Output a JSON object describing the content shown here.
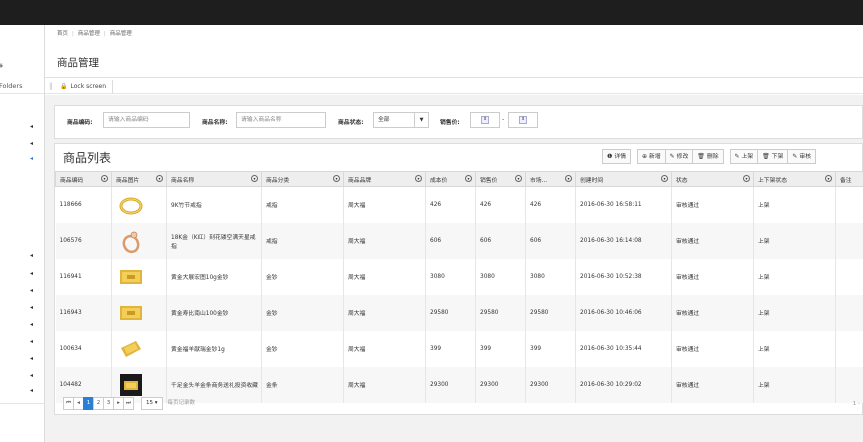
{
  "sidebar": {
    "top_label": "#",
    "folders_label": "Folders"
  },
  "breadcrumb": [
    "首页",
    "商品管理",
    "商品管理"
  ],
  "page_title": "商品管理",
  "tabs": {
    "lock_screen": "Lock screen"
  },
  "search": {
    "code_label": "商品编码:",
    "code_placeholder": "请输入商品编码",
    "name_label": "商品名称:",
    "name_placeholder": "请输入商品名称",
    "status_label": "商品状态:",
    "status_value": "全部",
    "price_label": "销售价:",
    "price_sep": "-"
  },
  "list": {
    "title": "商品列表",
    "toolbar": {
      "detail": "详情",
      "add": "新增",
      "edit": "修改",
      "delete": "删除",
      "up": "上架",
      "down": "下架",
      "review": "审核"
    },
    "columns": [
      "商品编码",
      "商品图片",
      "商品名称",
      "商品分类",
      "商品品牌",
      "成本价",
      "销售价",
      "市场...",
      "创建时间",
      "状态",
      "上下架状态",
      "备注"
    ],
    "rows": [
      {
        "code": "118666",
        "name": "9K竹节戒指",
        "category": "戒指",
        "brand": "周大福",
        "cost": "426",
        "sale": "426",
        "market": "426",
        "created": "2016-06-30 16:58:11",
        "status": "审核通过",
        "shelf": "上架",
        "remark": "",
        "thumb": "ring-gold"
      },
      {
        "code": "106576",
        "name": "18K金（K红）刻花镂空满天星戒指",
        "category": "戒指",
        "brand": "周大福",
        "cost": "606",
        "sale": "606",
        "market": "606",
        "created": "2016-06-30 16:14:08",
        "status": "审核通过",
        "shelf": "上架",
        "remark": "",
        "thumb": "ring-rose"
      },
      {
        "code": "116941",
        "name": "黄金大展宏图10g金钞",
        "category": "金钞",
        "brand": "周大福",
        "cost": "3080",
        "sale": "3080",
        "market": "3080",
        "created": "2016-06-30 10:52:38",
        "status": "审核通过",
        "shelf": "上架",
        "remark": "",
        "thumb": "gold-bar"
      },
      {
        "code": "116943",
        "name": "黄金寿比南山100金钞",
        "category": "金钞",
        "brand": "周大福",
        "cost": "29580",
        "sale": "29580",
        "market": "29580",
        "created": "2016-06-30 10:46:06",
        "status": "审核通过",
        "shelf": "上架",
        "remark": "",
        "thumb": "gold-bar"
      },
      {
        "code": "100634",
        "name": "黄金福羊献瑞金钞1g",
        "category": "金钞",
        "brand": "周大福",
        "cost": "399",
        "sale": "399",
        "market": "399",
        "created": "2016-06-30 10:35:44",
        "status": "审核通过",
        "shelf": "上架",
        "remark": "",
        "thumb": "gold-card"
      },
      {
        "code": "104482",
        "name": "千足金头羊金条商务送礼投资收藏",
        "category": "金条",
        "brand": "周大福",
        "cost": "29300",
        "sale": "29300",
        "market": "29300",
        "created": "2016-06-30 10:29:02",
        "status": "审核通过",
        "shelf": "上架",
        "remark": "",
        "thumb": "gold-box"
      }
    ]
  },
  "pager": {
    "first": "⏮",
    "prev": "◂",
    "pages": [
      "1",
      "2",
      "3"
    ],
    "next": "▸",
    "last": "⏭",
    "page_size": "15",
    "page_size_label": "每页记录数",
    "right_text": "1 -"
  },
  "colors": {
    "accent": "#2d7fd3",
    "topbar": "#1e1e1e",
    "gold": "#e1b53b"
  }
}
